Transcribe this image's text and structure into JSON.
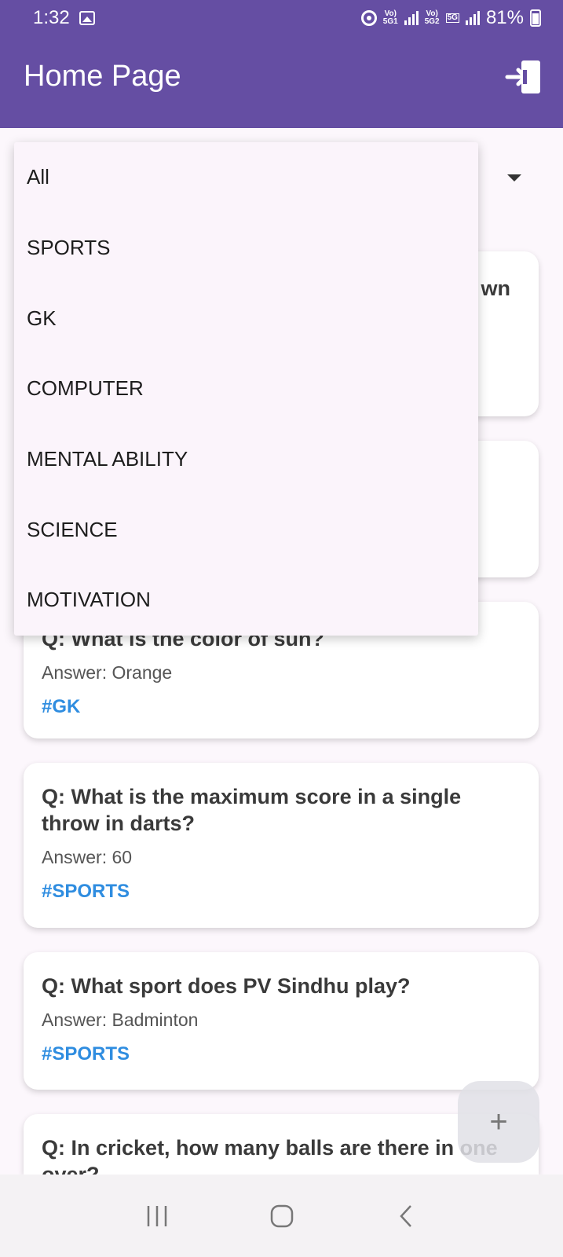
{
  "status_bar": {
    "time": "1:32",
    "battery": "81%",
    "net1_top": "Vo)",
    "net1_bottom": "5G1",
    "net2_top": "Vo)",
    "net2_bottom": "5G2",
    "net_badge": "5G"
  },
  "app_bar": {
    "title": "Home Page",
    "logout_icon": "logout-icon"
  },
  "filter_dropdown": {
    "options": [
      "All",
      "SPORTS",
      "GK",
      "COMPUTER",
      "MENTAL ABILITY",
      "SCIENCE",
      "MOTIVATION"
    ]
  },
  "cards": [
    {
      "partial_text": "wn"
    },
    {
      "question": "Q: What is the color of sun?",
      "answer": "Answer: Orange",
      "tag": "#GK"
    },
    {
      "question": "Q: What is the maximum score in a single throw in darts?",
      "answer": "Answer: 60",
      "tag": "#SPORTS"
    },
    {
      "question": "Q: What sport does PV Sindhu play?",
      "answer": "Answer: Badminton",
      "tag": "#SPORTS"
    },
    {
      "question": "Q: In cricket, how many balls are there in one over?"
    }
  ],
  "fab": {
    "label": "+"
  },
  "colors": {
    "primary": "#654ea3",
    "tag": "#2f8de0"
  }
}
